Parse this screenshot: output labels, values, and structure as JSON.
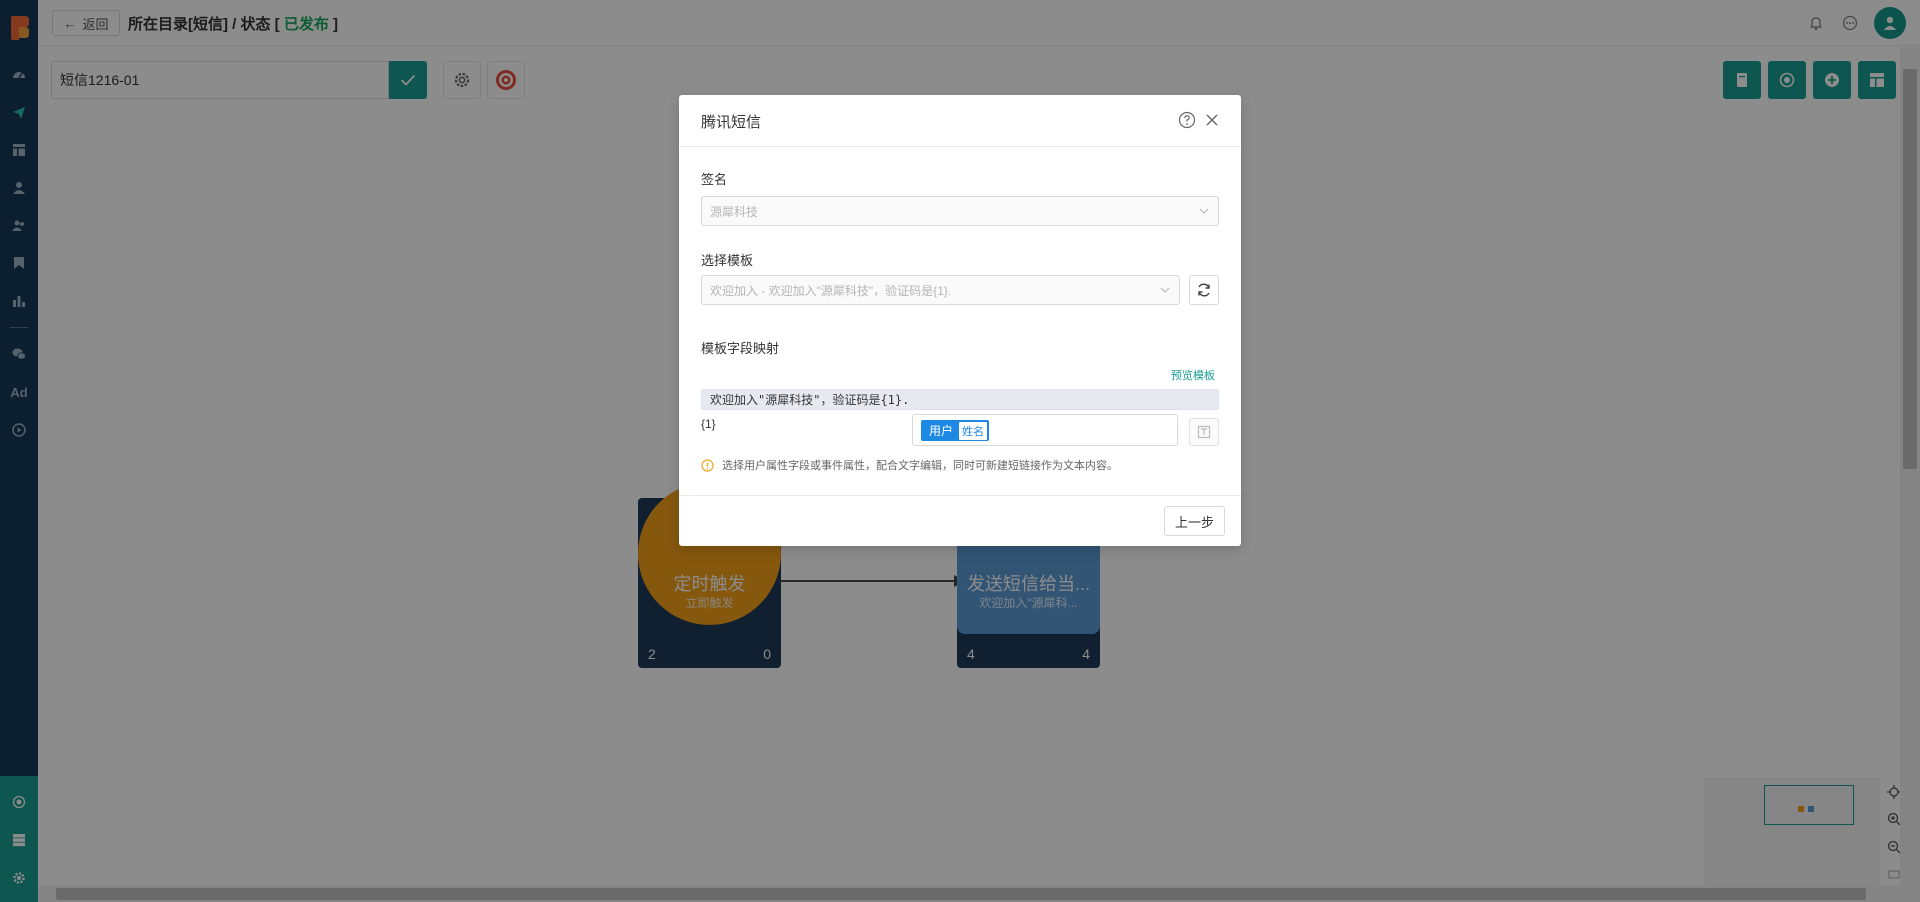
{
  "header": {
    "back_label": "返回",
    "breadcrumb_path": "所在目录[短信] / 状态 [",
    "status": "已发布",
    "breadcrumb_end": "]"
  },
  "sidebar": {
    "items": [
      {
        "icon": "dashboard-icon"
      },
      {
        "icon": "send-icon"
      },
      {
        "icon": "layout-icon"
      },
      {
        "icon": "user-icon"
      },
      {
        "icon": "users-icon"
      },
      {
        "icon": "bookmark-icon"
      },
      {
        "icon": "bar-chart-icon"
      },
      {
        "icon": "wechat-icon"
      },
      {
        "label": "Ad"
      },
      {
        "icon": "play-icon"
      }
    ],
    "bottom_items": [
      {
        "icon": "network-icon"
      },
      {
        "icon": "server-icon"
      },
      {
        "icon": "settings-icon"
      }
    ]
  },
  "canvas": {
    "journey_name": "短信1216-01",
    "nodes": [
      {
        "type": "trigger",
        "title": "定时触发",
        "subtitle": "立即触发",
        "count_in": "2",
        "count_out": "0",
        "color": "#f3a118"
      },
      {
        "type": "sms",
        "title": "发送短信给当...",
        "subtitle": "欢迎加入\"源犀科...",
        "count_in": "4",
        "count_out": "4",
        "color": "#5b9bd5"
      }
    ]
  },
  "modal": {
    "title": "腾讯短信",
    "signature_label": "签名",
    "signature_value": "源犀科技",
    "template_label": "选择模板",
    "template_value": "欢迎加入 - 欢迎加入\"源犀科技\"，验证码是{1}.",
    "mapping_label": "模板字段映射",
    "preview_link": "预览模板",
    "template_text": "欢迎加入\"源犀科技\"，验证码是{1}.",
    "param_name": "{1}",
    "param_tag_main": "用户",
    "param_tag_attr": "姓名",
    "hint": "选择用户属性字段或事件属性，配合文字编辑，同时可新建短链接作为文本内容。",
    "prev_button": "上一步"
  },
  "colors": {
    "accent": "#189e92",
    "status_green": "#19a75a",
    "sidebar": "#143a5a",
    "tag_blue": "#1e88e5"
  }
}
